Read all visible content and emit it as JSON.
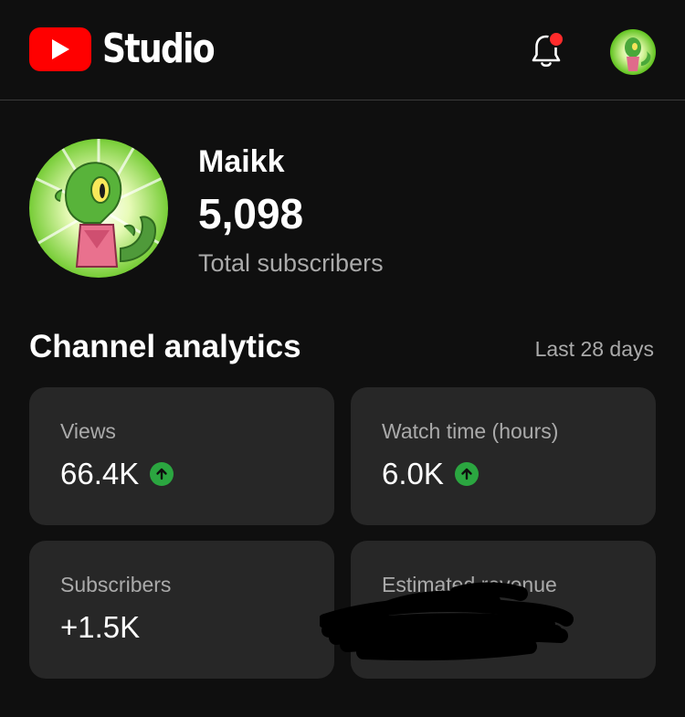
{
  "header": {
    "app_name": "Studio",
    "logo_icon": "youtube-play-icon",
    "notification_icon": "bell-icon",
    "notification_dot_color": "#ff2b2b",
    "brand_color": "#ff0000"
  },
  "channel": {
    "name": "Maikk",
    "subscriber_count": "5,098",
    "subscriber_label": "Total subscribers"
  },
  "analytics": {
    "title": "Channel analytics",
    "period": "Last 28 days",
    "cards": [
      {
        "label": "Views",
        "value": "66.4K",
        "trend": "up"
      },
      {
        "label": "Watch time (hours)",
        "value": "6.0K",
        "trend": "up"
      },
      {
        "label": "Subscribers",
        "value": "+1.5K"
      },
      {
        "label": "Estimated revenue",
        "value_redacted": true
      }
    ],
    "trend_color": "#2ba640"
  }
}
